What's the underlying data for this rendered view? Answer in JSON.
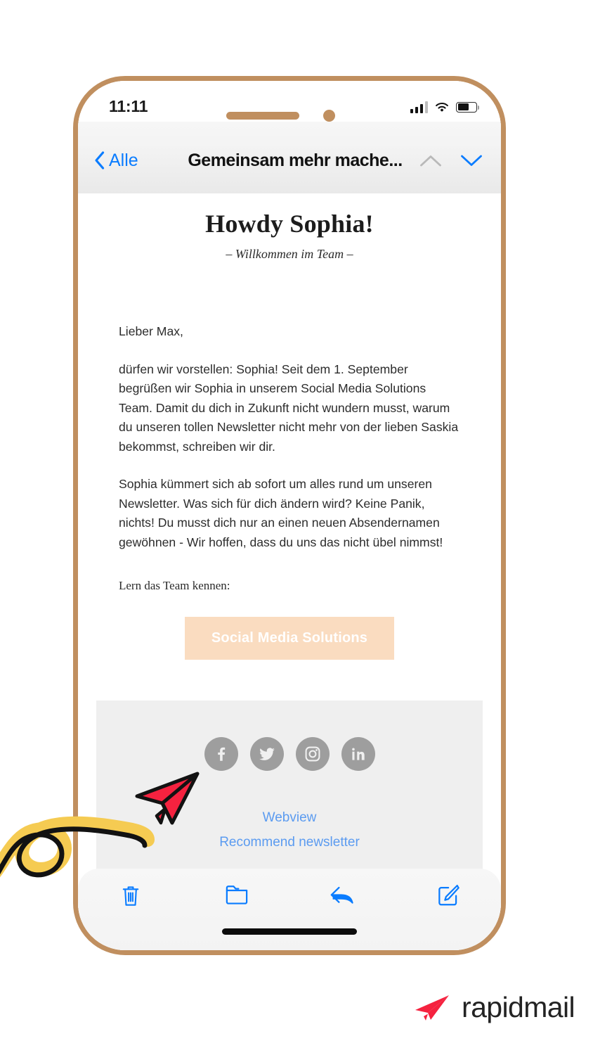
{
  "status_bar": {
    "time": "11:11",
    "signal_icon": "cellular-signal-icon",
    "wifi_icon": "wifi-icon",
    "battery_icon": "battery-icon",
    "battery_level": 60
  },
  "nav_bar": {
    "back_label": "Alle",
    "back_icon": "chevron-left-icon",
    "title": "Gemeinsam mehr mache...",
    "prev_icon": "chevron-up-icon",
    "next_icon": "chevron-down-icon",
    "prev_enabled": false,
    "next_enabled": true
  },
  "email": {
    "heading": "Howdy Sophia!",
    "subheading": "– Willkommen im Team –",
    "paragraphs": [
      "Lieber Max,",
      "dürfen wir vorstellen: Sophia! Seit dem 1. September begrüßen wir Sophia in unserem Social Media Solutions Team. Damit du dich in Zukunft nicht wundern musst, warum du unseren tollen Newsletter nicht mehr von der lieben Saskia bekommst, schreiben wir dir.",
      "Sophia kümmert sich ab sofort um alles rund um unseren Newsletter. Was sich für dich ändern wird? Keine Panik, nichts! Du musst dich nur an einen neuen Absendernamen gewöhnen - Wir hoffen, dass du uns das nicht übel nimmst!"
    ],
    "cta_lead": "Lern das Team kennen:",
    "cta_label": "Social Media Solutions",
    "cta_bg_color": "#fadcc0",
    "cta_text_color": "#ffffff"
  },
  "footer": {
    "social": [
      {
        "name": "facebook-icon",
        "label": "Facebook"
      },
      {
        "name": "twitter-icon",
        "label": "Twitter"
      },
      {
        "name": "instagram-icon",
        "label": "Instagram"
      },
      {
        "name": "linkedin-icon",
        "label": "LinkedIn"
      }
    ],
    "links": [
      {
        "label": "Webview"
      },
      {
        "label": "Recommend newsletter"
      }
    ],
    "link_color": "#5b9bf0",
    "bg_color": "#efefef"
  },
  "toolbar": {
    "items": [
      {
        "icon": "trash-icon",
        "label": "Delete"
      },
      {
        "icon": "folder-icon",
        "label": "Move to folder"
      },
      {
        "icon": "reply-icon",
        "label": "Reply"
      },
      {
        "icon": "compose-icon",
        "label": "Compose"
      }
    ],
    "icon_color": "#0a7cff"
  },
  "decoration": {
    "doodle_icon": "paper-plane-swirl-doodle",
    "swirl_color": "#f5cb52",
    "line_color": "#111111",
    "plane_color": "#f5223f"
  },
  "brand": {
    "name": "rapidmail",
    "logo_icon": "rapidmail-paper-plane-icon",
    "logo_color": "#f5223f",
    "text_color": "#232323"
  },
  "device": {
    "frame_color": "#c08f5f",
    "notch_icon": "speaker-and-camera",
    "home_indicator": "home-indicator-bar"
  }
}
